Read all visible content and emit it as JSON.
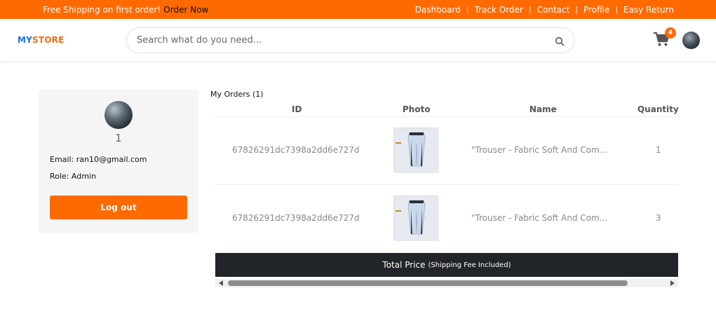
{
  "topbar": {
    "promo_text": "Free Shipping on first order!",
    "promo_link": "Order Now",
    "nav": [
      "Dashboard",
      "Track Order",
      "Contact",
      "Profile",
      "Easy Return"
    ],
    "separator": "|"
  },
  "header": {
    "logo_my": "MY",
    "logo_store": "STORE",
    "search_placeholder": "Search what do you need...",
    "cart_count": "4"
  },
  "profile": {
    "username": "1",
    "email": "Email: ran10@gmail.com",
    "role": "Role: Admin",
    "logout_label": "Log out"
  },
  "orders": {
    "title": "My Orders (1)",
    "columns": [
      "ID",
      "Photo",
      "Name",
      "Quantity"
    ],
    "rows": [
      {
        "id": "67826291dc7398a2dd6e727d",
        "name": "\"Trouser - Fabric Soft And Com...",
        "quantity": "1"
      },
      {
        "id": "67826291dc7398a2dd6e727d",
        "name": "\"Trouser - Fabric Soft And Com...",
        "quantity": "3"
      }
    ],
    "total_label": "Total Price",
    "total_note": "(Shipping Fee Included)"
  },
  "colors": {
    "accent": "#ff6a00",
    "brand_blue": "#1b6fe3",
    "dark": "#212529"
  }
}
